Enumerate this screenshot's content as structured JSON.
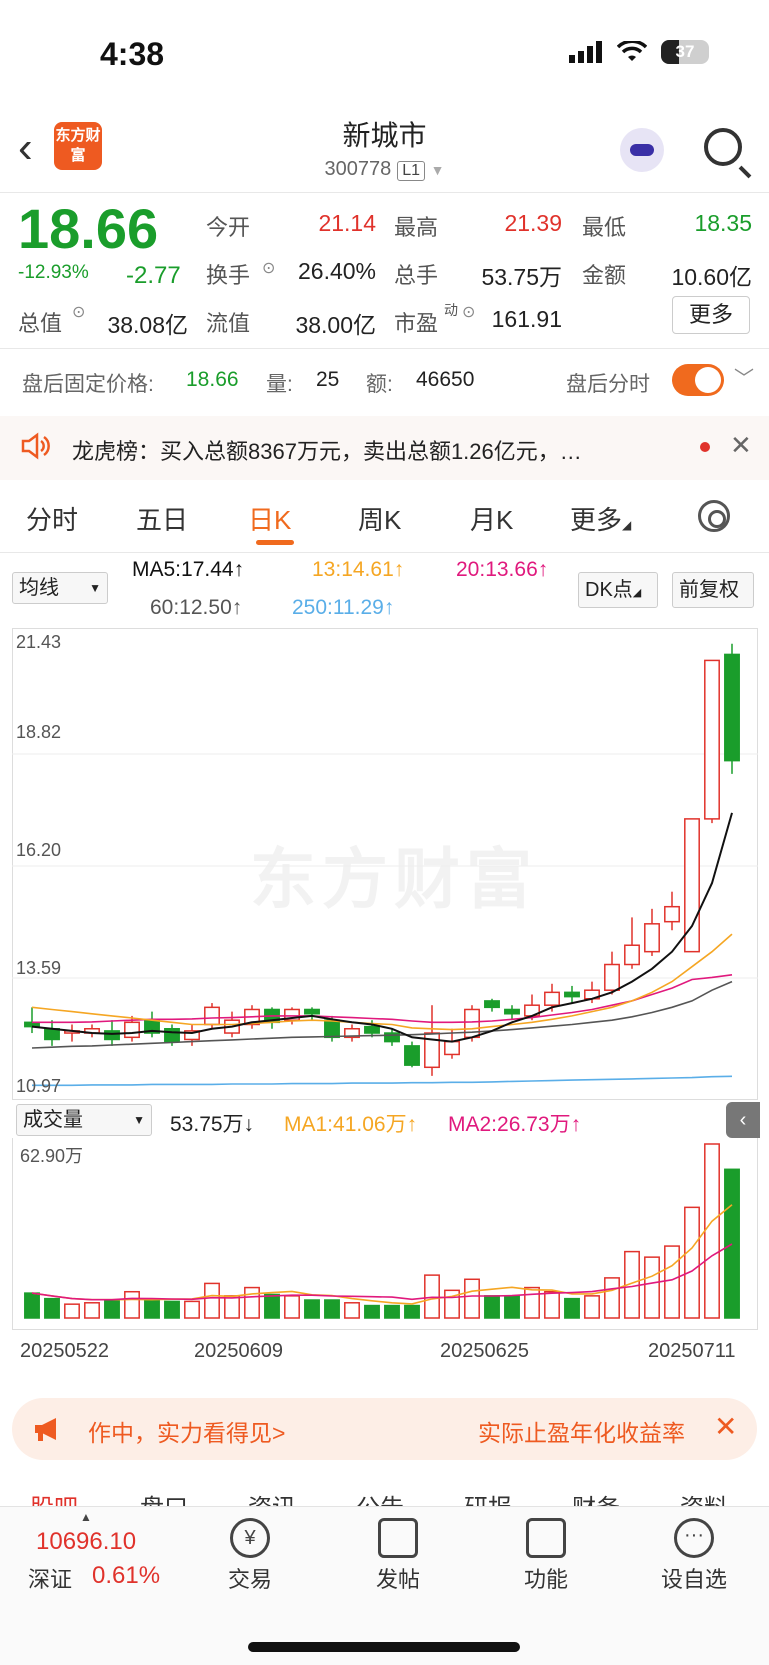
{
  "status": {
    "time": "4:38",
    "battery": "37"
  },
  "header": {
    "logo": "东方财富",
    "title": "新城市",
    "code": "300778",
    "level": "L1"
  },
  "quote": {
    "price": "18.66",
    "change_pct": "-12.93%",
    "change": "-2.77",
    "open_label": "今开",
    "open": "21.14",
    "high_label": "最高",
    "high": "21.39",
    "low_label": "最低",
    "low": "18.35",
    "turnover_label": "换手",
    "turnover": "26.40%",
    "volume_label": "总手",
    "volume": "53.75万",
    "amount_label": "金额",
    "amount": "10.60亿",
    "mcap_label": "总值",
    "mcap": "38.08亿",
    "float_label": "流值",
    "float": "38.00亿",
    "pe_label": "市盈",
    "pe_sup": "动",
    "pe": "161.91",
    "more": "更多"
  },
  "after_hours": {
    "price_label": "盘后固定价格:",
    "price": "18.66",
    "vol_label": "量:",
    "vol": "25",
    "amt_label": "额:",
    "amt": "46650",
    "tick_label": "盘后分时"
  },
  "notice": {
    "text": "龙虎榜：买入总额8367万元，卖出总额1.26亿元，…"
  },
  "tabs": [
    "分时",
    "五日",
    "日K",
    "周K",
    "月K",
    "更多"
  ],
  "indicators": {
    "ma_select": "均线",
    "ma5": "MA5:17.44↑",
    "ma13": "13:14.61↑",
    "ma20": "20:13.66↑",
    "ma60": "60:12.50↑",
    "ma250": "250:11.29↑",
    "dk": "DK点",
    "adjust": "前复权"
  },
  "volume_panel": {
    "select": "成交量",
    "vol": "53.75万↓",
    "ma1": "MA1:41.06万↑",
    "ma2": "MA2:26.73万↑",
    "ymax": "62.90万"
  },
  "watermark": "东方财富",
  "colors": {
    "up": "#e0322b",
    "down": "#1a9d2b",
    "ma5": "#111111",
    "ma13": "#f5a623",
    "ma20": "#e0197d",
    "ma60": "#555555",
    "ma250": "#5aaee8"
  },
  "chart_data": {
    "type": "candlestick",
    "y_ticks": [
      "21.43",
      "18.82",
      "16.20",
      "13.59",
      "10.97"
    ],
    "ylim": [
      10.97,
      21.43
    ],
    "x_labels": [
      "20250522",
      "20250609",
      "20250625",
      "20250711"
    ],
    "candles": [
      {
        "o": 12.55,
        "c": 12.45,
        "h": 12.9,
        "l": 12.3
      },
      {
        "o": 12.4,
        "c": 12.15,
        "h": 12.6,
        "l": 12.0
      },
      {
        "o": 12.3,
        "c": 12.35,
        "h": 12.5,
        "l": 12.1
      },
      {
        "o": 12.3,
        "c": 12.4,
        "h": 12.5,
        "l": 12.2
      },
      {
        "o": 12.35,
        "c": 12.15,
        "h": 12.6,
        "l": 12.0
      },
      {
        "o": 12.2,
        "c": 12.55,
        "h": 12.7,
        "l": 12.1
      },
      {
        "o": 12.6,
        "c": 12.3,
        "h": 12.8,
        "l": 12.2
      },
      {
        "o": 12.4,
        "c": 12.1,
        "h": 12.5,
        "l": 12.0
      },
      {
        "o": 12.15,
        "c": 12.35,
        "h": 12.5,
        "l": 12.0
      },
      {
        "o": 12.5,
        "c": 12.9,
        "h": 13.0,
        "l": 12.4
      },
      {
        "o": 12.3,
        "c": 12.6,
        "h": 12.8,
        "l": 12.2
      },
      {
        "o": 12.5,
        "c": 12.85,
        "h": 12.95,
        "l": 12.4
      },
      {
        "o": 12.85,
        "c": 12.55,
        "h": 12.9,
        "l": 12.4
      },
      {
        "o": 12.6,
        "c": 12.85,
        "h": 12.9,
        "l": 12.5
      },
      {
        "o": 12.85,
        "c": 12.75,
        "h": 12.9,
        "l": 12.6
      },
      {
        "o": 12.6,
        "c": 12.2,
        "h": 12.7,
        "l": 12.1
      },
      {
        "o": 12.2,
        "c": 12.4,
        "h": 12.5,
        "l": 12.1
      },
      {
        "o": 12.45,
        "c": 12.3,
        "h": 12.6,
        "l": 12.2
      },
      {
        "o": 12.3,
        "c": 12.1,
        "h": 12.4,
        "l": 12.0
      },
      {
        "o": 12.0,
        "c": 11.55,
        "h": 12.1,
        "l": 11.5
      },
      {
        "o": 11.5,
        "c": 12.3,
        "h": 12.95,
        "l": 11.3
      },
      {
        "o": 11.8,
        "c": 12.1,
        "h": 12.4,
        "l": 11.7
      },
      {
        "o": 12.2,
        "c": 12.85,
        "h": 12.95,
        "l": 12.1
      },
      {
        "o": 13.05,
        "c": 12.9,
        "h": 13.1,
        "l": 12.8
      },
      {
        "o": 12.85,
        "c": 12.75,
        "h": 12.95,
        "l": 12.6
      },
      {
        "o": 12.7,
        "c": 12.95,
        "h": 13.2,
        "l": 12.6
      },
      {
        "o": 12.95,
        "c": 13.25,
        "h": 13.45,
        "l": 12.8
      },
      {
        "o": 13.25,
        "c": 13.15,
        "h": 13.4,
        "l": 13.0
      },
      {
        "o": 13.1,
        "c": 13.3,
        "h": 13.5,
        "l": 13.0
      },
      {
        "o": 13.3,
        "c": 13.9,
        "h": 14.2,
        "l": 13.2
      },
      {
        "o": 13.9,
        "c": 14.35,
        "h": 15.0,
        "l": 13.8
      },
      {
        "o": 14.2,
        "c": 14.85,
        "h": 15.2,
        "l": 14.1
      },
      {
        "o": 14.9,
        "c": 15.25,
        "h": 15.6,
        "l": 14.7
      },
      {
        "o": 14.2,
        "c": 17.3,
        "h": 17.3,
        "l": 14.2
      },
      {
        "o": 17.3,
        "c": 21.0,
        "h": 21.0,
        "l": 17.2
      },
      {
        "o": 21.14,
        "c": 18.66,
        "h": 21.39,
        "l": 18.35
      }
    ],
    "ma5": [
      12.45,
      12.4,
      12.35,
      12.3,
      12.28,
      12.3,
      12.35,
      12.32,
      12.3,
      12.4,
      12.45,
      12.55,
      12.6,
      12.65,
      12.7,
      12.62,
      12.55,
      12.5,
      12.4,
      12.2,
      12.15,
      12.1,
      12.2,
      12.35,
      12.55,
      12.7,
      12.9,
      13.0,
      13.1,
      13.25,
      13.5,
      13.8,
      14.2,
      14.8,
      15.8,
      17.44
    ],
    "ma13": [
      12.9,
      12.85,
      12.8,
      12.75,
      12.7,
      12.65,
      12.6,
      12.55,
      12.5,
      12.5,
      12.5,
      12.52,
      12.55,
      12.58,
      12.6,
      12.58,
      12.55,
      12.52,
      12.5,
      12.42,
      12.4,
      12.38,
      12.4,
      12.45,
      12.5,
      12.55,
      12.62,
      12.7,
      12.8,
      12.9,
      13.05,
      13.25,
      13.5,
      13.85,
      14.2,
      14.61
    ],
    "ma20": [
      12.55,
      12.55,
      12.55,
      12.56,
      12.58,
      12.6,
      12.62,
      12.62,
      12.63,
      12.65,
      12.66,
      12.68,
      12.7,
      12.7,
      12.7,
      12.68,
      12.66,
      12.64,
      12.62,
      12.58,
      12.55,
      12.55,
      12.56,
      12.58,
      12.62,
      12.66,
      12.72,
      12.78,
      12.85,
      12.95,
      13.05,
      13.2,
      13.35,
      13.55,
      13.6,
      13.66
    ],
    "ma60": [
      11.95,
      11.97,
      11.99,
      12.0,
      12.02,
      12.04,
      12.06,
      12.08,
      12.1,
      12.12,
      12.14,
      12.16,
      12.18,
      12.2,
      12.21,
      12.22,
      12.23,
      12.24,
      12.25,
      12.26,
      12.28,
      12.3,
      12.32,
      12.35,
      12.38,
      12.42,
      12.46,
      12.5,
      12.55,
      12.6,
      12.68,
      12.78,
      12.9,
      13.05,
      13.3,
      13.5
    ],
    "ma250": [
      11.08,
      11.08,
      11.08,
      11.09,
      11.09,
      11.09,
      11.1,
      11.1,
      11.1,
      11.1,
      11.11,
      11.11,
      11.11,
      11.12,
      11.12,
      11.12,
      11.13,
      11.13,
      11.13,
      11.14,
      11.14,
      11.15,
      11.15,
      11.16,
      11.17,
      11.18,
      11.19,
      11.2,
      11.21,
      11.22,
      11.23,
      11.24,
      11.25,
      11.26,
      11.28,
      11.29
    ],
    "volume_ymax": 62.9,
    "volumes": [
      9,
      7,
      5,
      5.5,
      6.5,
      9.5,
      6.5,
      6,
      6,
      12.5,
      8,
      11,
      8.5,
      8,
      6.5,
      6.5,
      5.5,
      4.5,
      4.5,
      4.5,
      15.5,
      10,
      14,
      8,
      8,
      11,
      9.5,
      7,
      8,
      14.5,
      24,
      22,
      26,
      40,
      62.9,
      53.75
    ]
  }
}
